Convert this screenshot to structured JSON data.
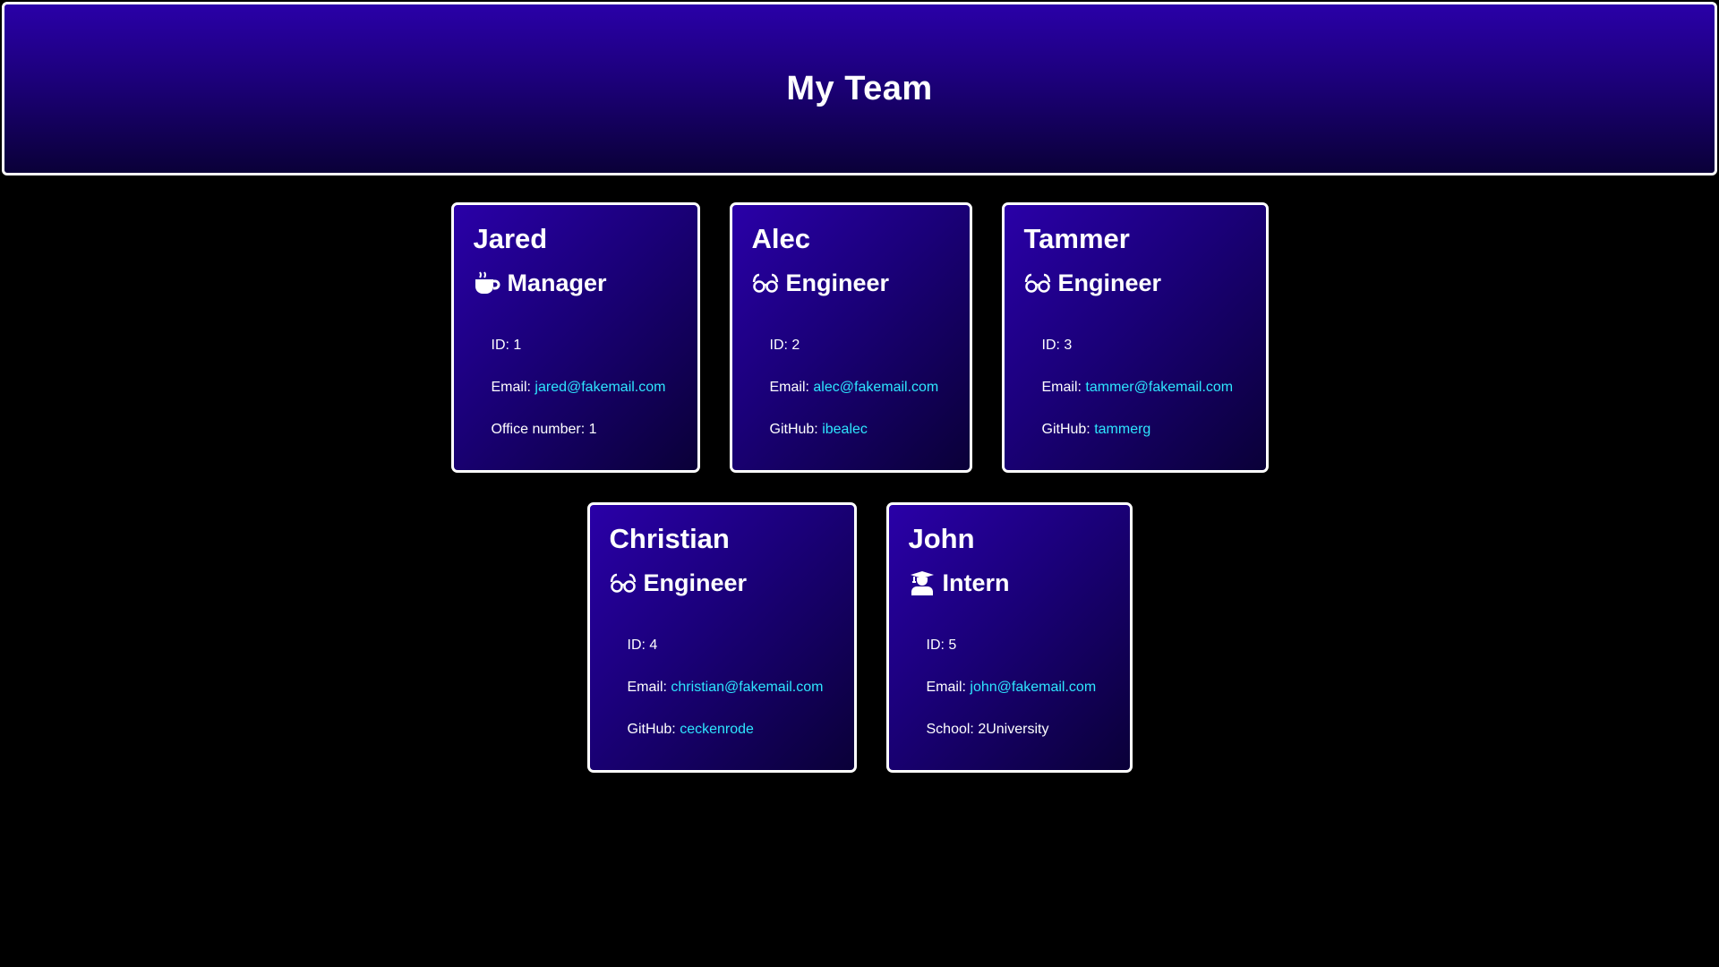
{
  "page": {
    "title": "My Team"
  },
  "colors": {
    "background": "#000000",
    "card_gradient_start": "#2a00a8",
    "card_gradient_end": "#0a0038",
    "link": "#2ee6ff",
    "border": "#ffffff"
  },
  "cards": [
    {
      "name": "Jared",
      "role": "Manager",
      "icon": "coffee-mug-icon",
      "id_label": "ID: 1",
      "email_label": "Email: ",
      "email": "jared@fakemail.com",
      "extra_label": "Office number: 1",
      "extra_link": ""
    },
    {
      "name": "Alec",
      "role": "Engineer",
      "icon": "glasses-icon",
      "id_label": "ID: 2",
      "email_label": "Email: ",
      "email": "alec@fakemail.com",
      "extra_label": "GitHub: ",
      "extra_link": "ibealec"
    },
    {
      "name": "Tammer",
      "role": "Engineer",
      "icon": "glasses-icon",
      "id_label": "ID: 3",
      "email_label": "Email: ",
      "email": "tammer@fakemail.com",
      "extra_label": "GitHub: ",
      "extra_link": "tammerg"
    },
    {
      "name": "Christian",
      "role": "Engineer",
      "icon": "glasses-icon",
      "id_label": "ID: 4",
      "email_label": "Email: ",
      "email": "christian@fakemail.com",
      "extra_label": "GitHub: ",
      "extra_link": "ceckenrode"
    },
    {
      "name": "John",
      "role": "Intern",
      "icon": "graduate-icon",
      "id_label": "ID: 5",
      "email_label": "Email: ",
      "email": "john@fakemail.com",
      "extra_label": "School: 2University",
      "extra_link": ""
    }
  ]
}
